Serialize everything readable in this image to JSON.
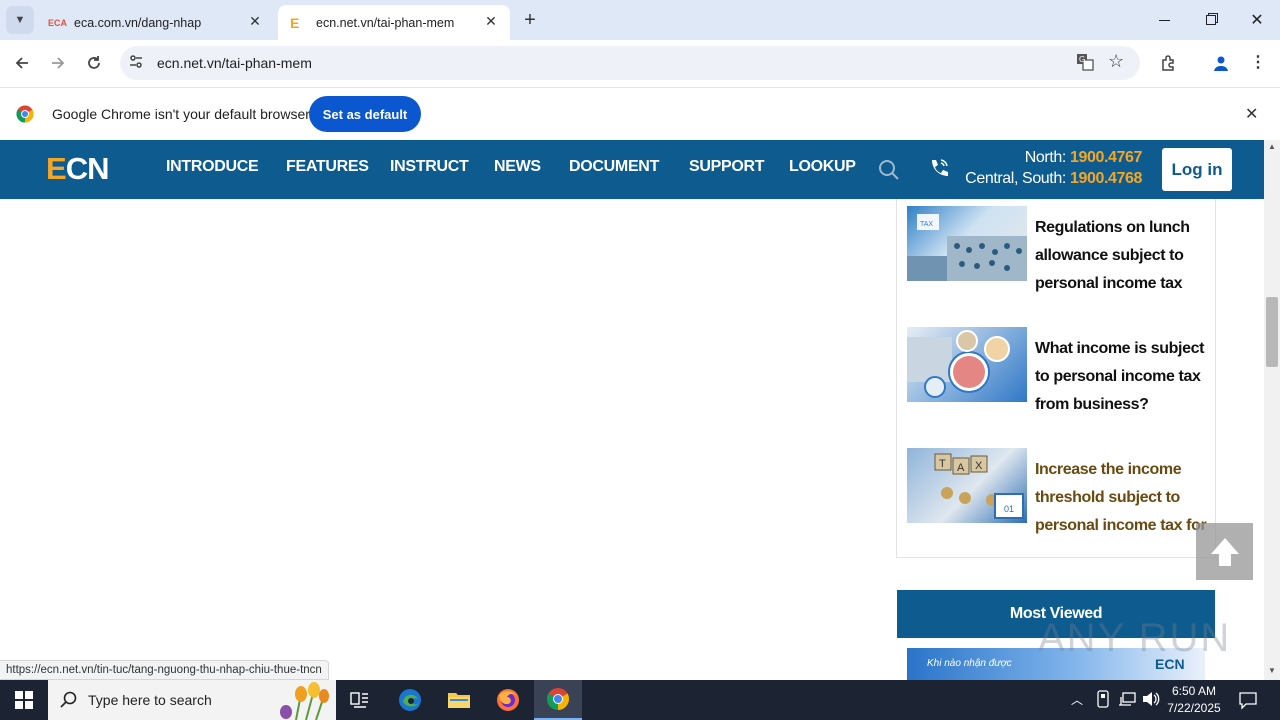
{
  "browser": {
    "tabs": [
      {
        "favicon": "ECA",
        "title": "eca.com.vn/dang-nhap",
        "active": false
      },
      {
        "favicon": "E",
        "title": "ecn.net.vn/tai-phan-mem",
        "active": true
      }
    ],
    "new_tab_symbol": "+",
    "address": "ecn.net.vn/tai-phan-mem",
    "infobar": {
      "message": "Google Chrome isn't your default browser",
      "button": "Set as default"
    },
    "status_url": "https://ecn.net.vn/tin-tuc/tang-nguong-thu-nhap-chiu-thue-tncn"
  },
  "site": {
    "logo": {
      "accent": "E",
      "rest": "CN"
    },
    "nav": [
      "INTRODUCE",
      "FEATURES",
      "INSTRUCT",
      "NEWS",
      "DOCUMENT",
      "SUPPORT",
      "LOOKUP"
    ],
    "hotline": {
      "north_label": "North:",
      "north_number": "1900.4767",
      "south_label": "Central, South:",
      "south_number": "1900.4768"
    },
    "login": "Log in",
    "articles": [
      {
        "title": "Regulations on lunch allowance subject to personal income tax"
      },
      {
        "title": "What income is subject to personal income tax from business?"
      },
      {
        "title": "Increase the income threshold subject to personal income tax for"
      }
    ],
    "most_viewed": "Most Viewed",
    "most_viewed_thumb_text": "Khi nào nhận được",
    "most_viewed_thumb_logo": "ECN",
    "watermark": "ANY RUN"
  },
  "colors": {
    "brand_blue": "#0d5b8f",
    "accent_orange": "#f5a623",
    "chrome_blue": "#0b57d0"
  },
  "taskbar": {
    "search_placeholder": "Type here to search",
    "time": "6:50 AM",
    "date": "7/22/2025"
  }
}
